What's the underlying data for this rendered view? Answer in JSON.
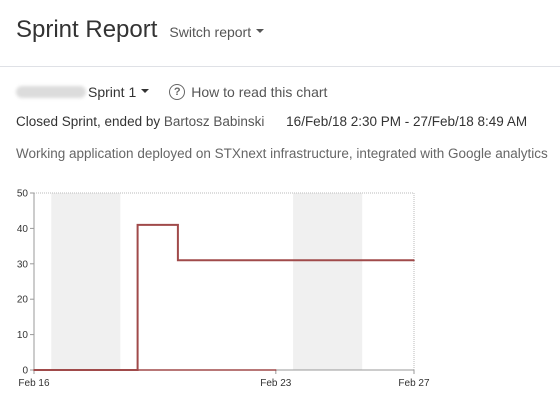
{
  "header": {
    "title": "Sprint Report",
    "switch_label": "Switch report"
  },
  "sprint": {
    "name": "Sprint 1",
    "help_label": "How to read this chart"
  },
  "status": {
    "prefix": "Closed Sprint, ended by",
    "user": "Bartosz Babinski",
    "dates": "16/Feb/18 2:30 PM - 27/Feb/18 8:49 AM"
  },
  "description": "Working application deployed on STXnext infrastructure, integrated with Google analytics",
  "colors": {
    "line": "#a04a4a",
    "weekend": "#f0f0f0",
    "grid": "#999999"
  },
  "chart_data": {
    "type": "line",
    "title": "",
    "xlabel": "",
    "ylabel": "",
    "ylim": [
      0,
      50
    ],
    "yticks": [
      0,
      10,
      20,
      30,
      40,
      50
    ],
    "xlim": [
      "2018-02-16",
      "2018-02-27"
    ],
    "xticks": [
      {
        "label": "Feb 16",
        "date": "2018-02-16"
      },
      {
        "label": "Feb 23",
        "date": "2018-02-23"
      },
      {
        "label": "Feb 27",
        "date": "2018-02-27"
      }
    ],
    "weekends": [
      {
        "start": "2018-02-16T12:00",
        "end": "2018-02-18T12:00"
      },
      {
        "start": "2018-02-23T12:00",
        "end": "2018-02-25T12:00"
      }
    ],
    "series": [
      {
        "points": [
          {
            "x": "2018-02-16T00:00",
            "y": 0
          },
          {
            "x": "2018-02-19T00:00",
            "y": 0
          },
          {
            "x": "2018-02-19T00:00",
            "y": 41
          },
          {
            "x": "2018-02-20T04:00",
            "y": 41
          },
          {
            "x": "2018-02-20T04:00",
            "y": 31
          },
          {
            "x": "2018-02-27T00:00",
            "y": 31
          }
        ]
      },
      {
        "points": [
          {
            "x": "2018-02-16T00:00",
            "y": 0
          },
          {
            "x": "2018-02-23T00:00",
            "y": 0
          }
        ]
      }
    ]
  }
}
